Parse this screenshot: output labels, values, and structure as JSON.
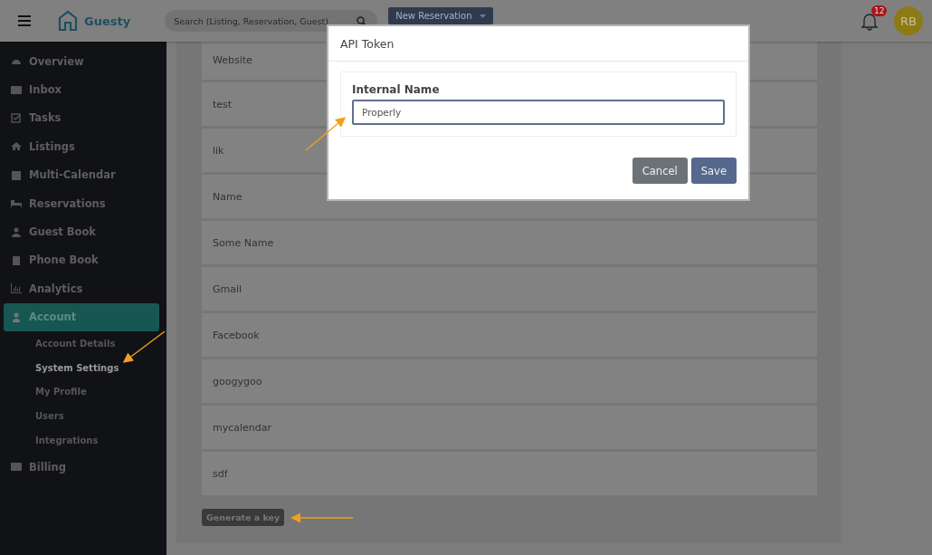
{
  "top_bar": {
    "brand": "Guesty",
    "search": {
      "placeholder": "Search (Listing, Reservation, Guest)"
    },
    "new_button": "New Reservation",
    "notifications": "12",
    "avatar": "RB"
  },
  "sidebar": {
    "items": [
      {
        "label": "Overview",
        "selected": false
      },
      {
        "label": "Inbox",
        "selected": false
      },
      {
        "label": "Tasks",
        "selected": false
      },
      {
        "label": "Listings",
        "selected": false
      },
      {
        "label": "Multi-Calendar",
        "selected": false
      },
      {
        "label": "Reservations",
        "selected": false
      },
      {
        "label": "Guest Book",
        "selected": false
      },
      {
        "label": "Phone Book",
        "selected": false
      },
      {
        "label": "Analytics",
        "selected": false
      },
      {
        "label": "Account",
        "selected": true,
        "children": [
          {
            "label": "Account Details",
            "selected": false
          },
          {
            "label": "System Settings",
            "selected": true
          },
          {
            "label": "My Profile",
            "selected": false
          },
          {
            "label": "Users",
            "selected": false
          },
          {
            "label": "Integrations",
            "selected": false
          }
        ]
      },
      {
        "label": "Billing",
        "selected": false
      }
    ]
  },
  "tokens": [
    "Website",
    "test",
    "lik",
    "Name",
    "Some Name",
    "Gmail",
    "Facebook",
    "googygoo",
    "mycalendar",
    "sdf"
  ],
  "generate_button": "Generate a key",
  "dialog": {
    "title": "API Token",
    "field_label": "Internal Name",
    "field_value": "Properly",
    "buttons": [
      "Cancel",
      "Save"
    ]
  }
}
